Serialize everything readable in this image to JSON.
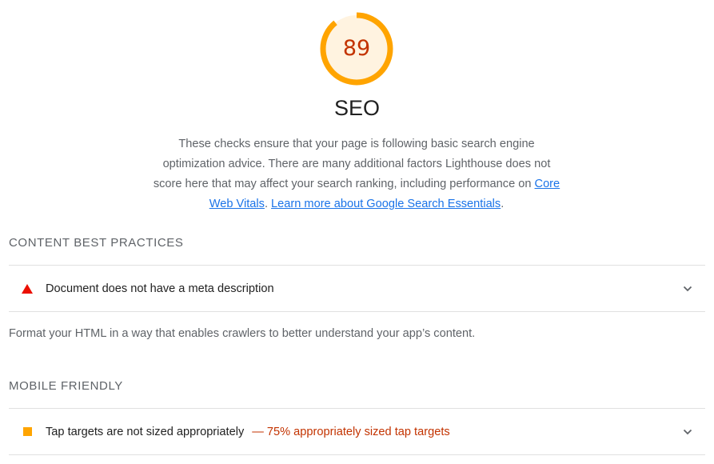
{
  "score": {
    "value": "89",
    "fraction": 0.89,
    "color": "#ffa400",
    "fill": "#fff3e0",
    "text_color": "#c33300"
  },
  "category": {
    "title": "SEO",
    "description_text": "These checks ensure that your page is following basic search engine optimization advice. There are many additional factors Lighthouse does not score here that may affect your search ranking, including performance on ",
    "link_core_web_vitals": "Core Web Vitals",
    "separator": ". ",
    "link_search_essentials": "Learn more about Google Search Essentials",
    "end": "."
  },
  "groups": [
    {
      "title": "CONTENT BEST PRACTICES",
      "description": "Format your HTML in a way that enables crawlers to better understand your app’s content.",
      "audits": [
        {
          "icon": "fail-triangle-icon",
          "icon_color": "#eb0f00",
          "title": "Document does not have a meta description",
          "display_value": ""
        }
      ]
    },
    {
      "title": "MOBILE FRIENDLY",
      "audits": [
        {
          "icon": "average-square-icon",
          "icon_color": "#ffa400",
          "title": "Tap targets are not sized appropriately",
          "display_value": "— 75% appropriately sized tap targets"
        }
      ]
    }
  ]
}
